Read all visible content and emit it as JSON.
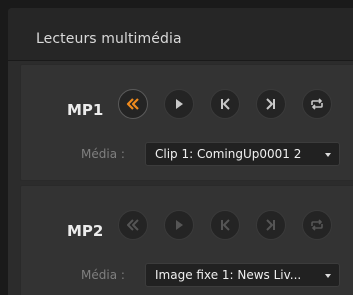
{
  "panel": {
    "title": "Lecteurs multimédia"
  },
  "players": [
    {
      "label": "MP1",
      "media_label": "Média :",
      "media_value": "Clip 1: ComingUp0001 2",
      "controls": [
        {
          "name": "rewind",
          "icon": "rewind-icon",
          "state": "active"
        },
        {
          "name": "play",
          "icon": "play-icon",
          "state": "normal"
        },
        {
          "name": "previous",
          "icon": "previous-icon",
          "state": "normal"
        },
        {
          "name": "next",
          "icon": "next-icon",
          "state": "normal"
        },
        {
          "name": "loop",
          "icon": "loop-icon",
          "state": "normal"
        }
      ]
    },
    {
      "label": "MP2",
      "media_label": "Média :",
      "media_value": "Image fixe 1: News Liv...",
      "controls": [
        {
          "name": "rewind",
          "icon": "rewind-icon",
          "state": "disabled"
        },
        {
          "name": "play",
          "icon": "play-icon",
          "state": "disabled"
        },
        {
          "name": "previous",
          "icon": "previous-icon",
          "state": "disabled"
        },
        {
          "name": "next",
          "icon": "next-icon",
          "state": "disabled"
        },
        {
          "name": "loop",
          "icon": "loop-icon",
          "state": "disabled"
        }
      ]
    }
  ],
  "colors": {
    "accent": "#f08a1c",
    "icon_normal": "#c8c8c8",
    "icon_disabled": "#555555",
    "background": "#2c2c2c"
  }
}
